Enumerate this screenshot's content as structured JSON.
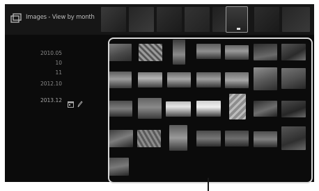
{
  "screen": {
    "title": "Images - View by month",
    "title_icon": "gallery-icon",
    "sidebar": {
      "dates": [
        "2010.05",
        "10",
        "11",
        "2012.10",
        "2013.12"
      ],
      "current_index": 4,
      "current_icons": [
        "calendar-icon",
        "pencil-icon"
      ]
    }
  }
}
